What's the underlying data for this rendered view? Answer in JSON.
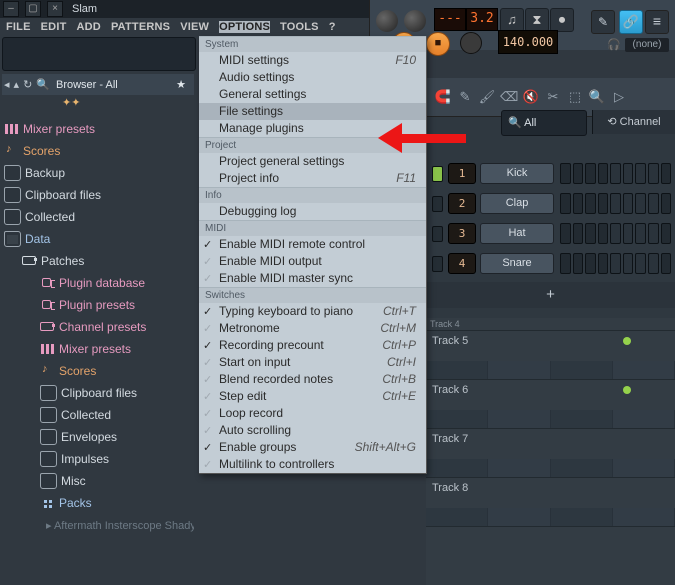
{
  "title": "Slam",
  "menubar": [
    "FILE",
    "EDIT",
    "ADD",
    "PATTERNS",
    "VIEW",
    "OPTIONS",
    "TOOLS",
    "?"
  ],
  "menubar_sel_index": 5,
  "lcd1": "---",
  "lcd2": "3.2",
  "tempo": "140.000",
  "none_label": "(none)",
  "browser_header": "Browser - All",
  "sparkle": "✦✦",
  "tree": [
    {
      "level": 0,
      "color": "pink",
      "icon": "mix",
      "label": "Mixer presets"
    },
    {
      "level": 0,
      "color": "orange",
      "icon": "note",
      "label": "Scores"
    },
    {
      "level": 0,
      "color": "white",
      "icon": "fold",
      "label": "Backup"
    },
    {
      "level": 0,
      "color": "white",
      "icon": "fold",
      "label": "Clipboard files"
    },
    {
      "level": 0,
      "color": "white",
      "icon": "fold",
      "label": "Collected"
    },
    {
      "level": 0,
      "color": "blue",
      "icon": "fold",
      "label": "Data",
      "open": true
    },
    {
      "level": 1,
      "color": "white",
      "icon": "patch",
      "label": "Patches",
      "open": true
    },
    {
      "level": 2,
      "color": "pink",
      "icon": "plug",
      "label": "Plugin database"
    },
    {
      "level": 2,
      "color": "pink",
      "icon": "plug",
      "label": "Plugin presets"
    },
    {
      "level": 2,
      "color": "pink",
      "icon": "patch",
      "label": "Channel presets"
    },
    {
      "level": 2,
      "color": "pink",
      "icon": "mix",
      "label": "Mixer presets"
    },
    {
      "level": 2,
      "color": "orange",
      "icon": "note",
      "label": "Scores"
    },
    {
      "level": 2,
      "color": "white",
      "icon": "fold",
      "label": "Clipboard files"
    },
    {
      "level": 2,
      "color": "white",
      "icon": "fold",
      "label": "Collected"
    },
    {
      "level": 2,
      "color": "white",
      "icon": "fold",
      "label": "Envelopes"
    },
    {
      "level": 2,
      "color": "white",
      "icon": "fold",
      "label": "Impulses"
    },
    {
      "level": 2,
      "color": "white",
      "icon": "fold",
      "label": "Misc"
    },
    {
      "level": 2,
      "color": "blue",
      "icon": "sq",
      "label": "Packs",
      "open": true
    }
  ],
  "tree_truncated": "Aftermath Insterscope Shady Records Drum Samples",
  "menu_sections": [
    {
      "title": "System",
      "items": [
        {
          "label": "MIDI settings",
          "shortcut": "F10"
        },
        {
          "label": "Audio settings"
        },
        {
          "label": "General settings"
        },
        {
          "label": "File settings",
          "highlight": true
        },
        {
          "label": "Manage plugins"
        }
      ]
    },
    {
      "title": "Project",
      "items": [
        {
          "label": "Project general settings"
        },
        {
          "label": "Project info",
          "shortcut": "F11"
        }
      ]
    },
    {
      "title": "Info",
      "items": [
        {
          "label": "Debugging log"
        }
      ]
    },
    {
      "title": "MIDI",
      "items": [
        {
          "label": "Enable MIDI remote control",
          "check": true
        },
        {
          "label": "Enable MIDI output",
          "check": "dim"
        },
        {
          "label": "Enable MIDI master sync",
          "check": "dim"
        }
      ]
    },
    {
      "title": "Switches",
      "items": [
        {
          "label": "Typing keyboard to piano",
          "shortcut": "Ctrl+T",
          "check": true
        },
        {
          "label": "Metronome",
          "shortcut": "Ctrl+M",
          "check": "dim"
        },
        {
          "label": "Recording precount",
          "shortcut": "Ctrl+P",
          "check": true
        },
        {
          "label": "Start on input",
          "shortcut": "Ctrl+I",
          "check": "dim"
        },
        {
          "label": "Blend recorded notes",
          "shortcut": "Ctrl+B",
          "check": "dim"
        },
        {
          "label": "Step edit",
          "shortcut": "Ctrl+E",
          "check": "dim"
        },
        {
          "label": "Loop record",
          "check": "dim"
        },
        {
          "label": "Auto scrolling",
          "check": "dim"
        },
        {
          "label": "Enable groups",
          "shortcut": "Shift+Alt+G",
          "check": true
        },
        {
          "label": "Multilink to controllers",
          "check": "dim"
        }
      ]
    }
  ],
  "channels": [
    {
      "num": "1",
      "name": "Kick"
    },
    {
      "num": "2",
      "name": "Clap"
    },
    {
      "num": "3",
      "name": "Hat"
    },
    {
      "num": "4",
      "name": "Snare"
    }
  ],
  "search_box": "All",
  "channel_btn": "⟲ Channel",
  "tracks": [
    "Track 4",
    "Track 5",
    "Track 6",
    "Track 7",
    "Track 8"
  ],
  "plus": "+"
}
